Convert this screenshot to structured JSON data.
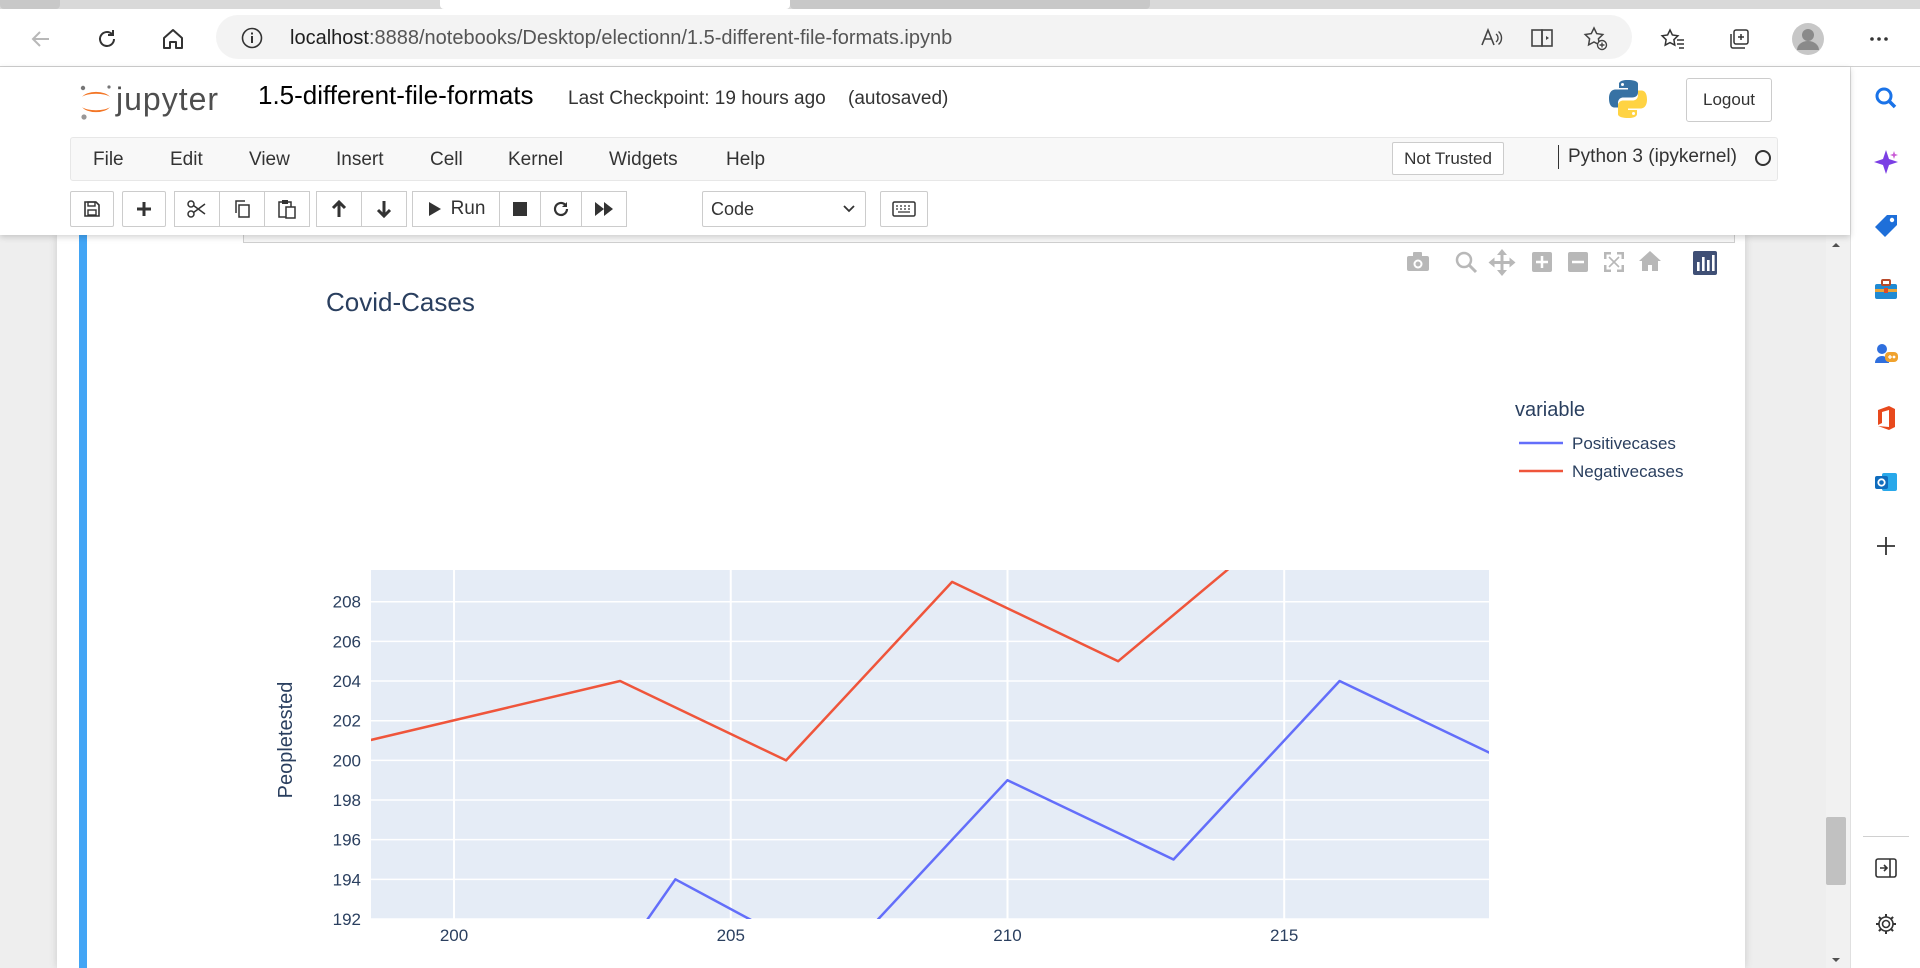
{
  "browser": {
    "url_host": "localhost",
    "url_path": ":8888/notebooks/Desktop/electionn/1.5-different-file-formats.ipynb"
  },
  "jupyter": {
    "logo_text": "jupyter",
    "notebook_name": "1.5-different-file-formats",
    "checkpoint": "Last Checkpoint: 19 hours ago",
    "autosaved": "(autosaved)",
    "logout_label": "Logout",
    "menu": [
      "File",
      "Edit",
      "View",
      "Insert",
      "Cell",
      "Kernel",
      "Widgets",
      "Help"
    ],
    "trust_label": "Not Trusted",
    "kernel_name": "Python 3 (ipykernel)",
    "toolbar": {
      "run_label": "Run",
      "cell_type": "Code"
    }
  },
  "colors": {
    "cell_selected_bar": "#42a5f5",
    "plot_bg": "#e5ecf6",
    "positive_line": "#636efa",
    "negative_line": "#ef553b"
  },
  "chart_data": {
    "type": "line",
    "title": "Covid-Cases",
    "xlabel": "",
    "ylabel": "Peopletested",
    "legend_title": "variable",
    "legend_position": "top-right",
    "xlim": [
      198.5,
      218.7
    ],
    "ylim": [
      192,
      209.6
    ],
    "xticks": [
      200,
      205,
      210,
      215
    ],
    "yticks": [
      192,
      194,
      196,
      198,
      200,
      202,
      204,
      206,
      208
    ],
    "grid": true,
    "series": [
      {
        "name": "Positivecases",
        "color": "#636efa",
        "x": [
          203,
          204,
          206,
          207,
          210,
          213,
          216,
          219
        ],
        "y": [
          190,
          194,
          191,
          190,
          199,
          195,
          204,
          200
        ]
      },
      {
        "name": "Negativecases",
        "color": "#ef553b",
        "x": [
          198,
          203,
          206,
          209,
          212,
          215
        ],
        "y": [
          200.7,
          204,
          200,
          209,
          205,
          212
        ]
      }
    ]
  }
}
